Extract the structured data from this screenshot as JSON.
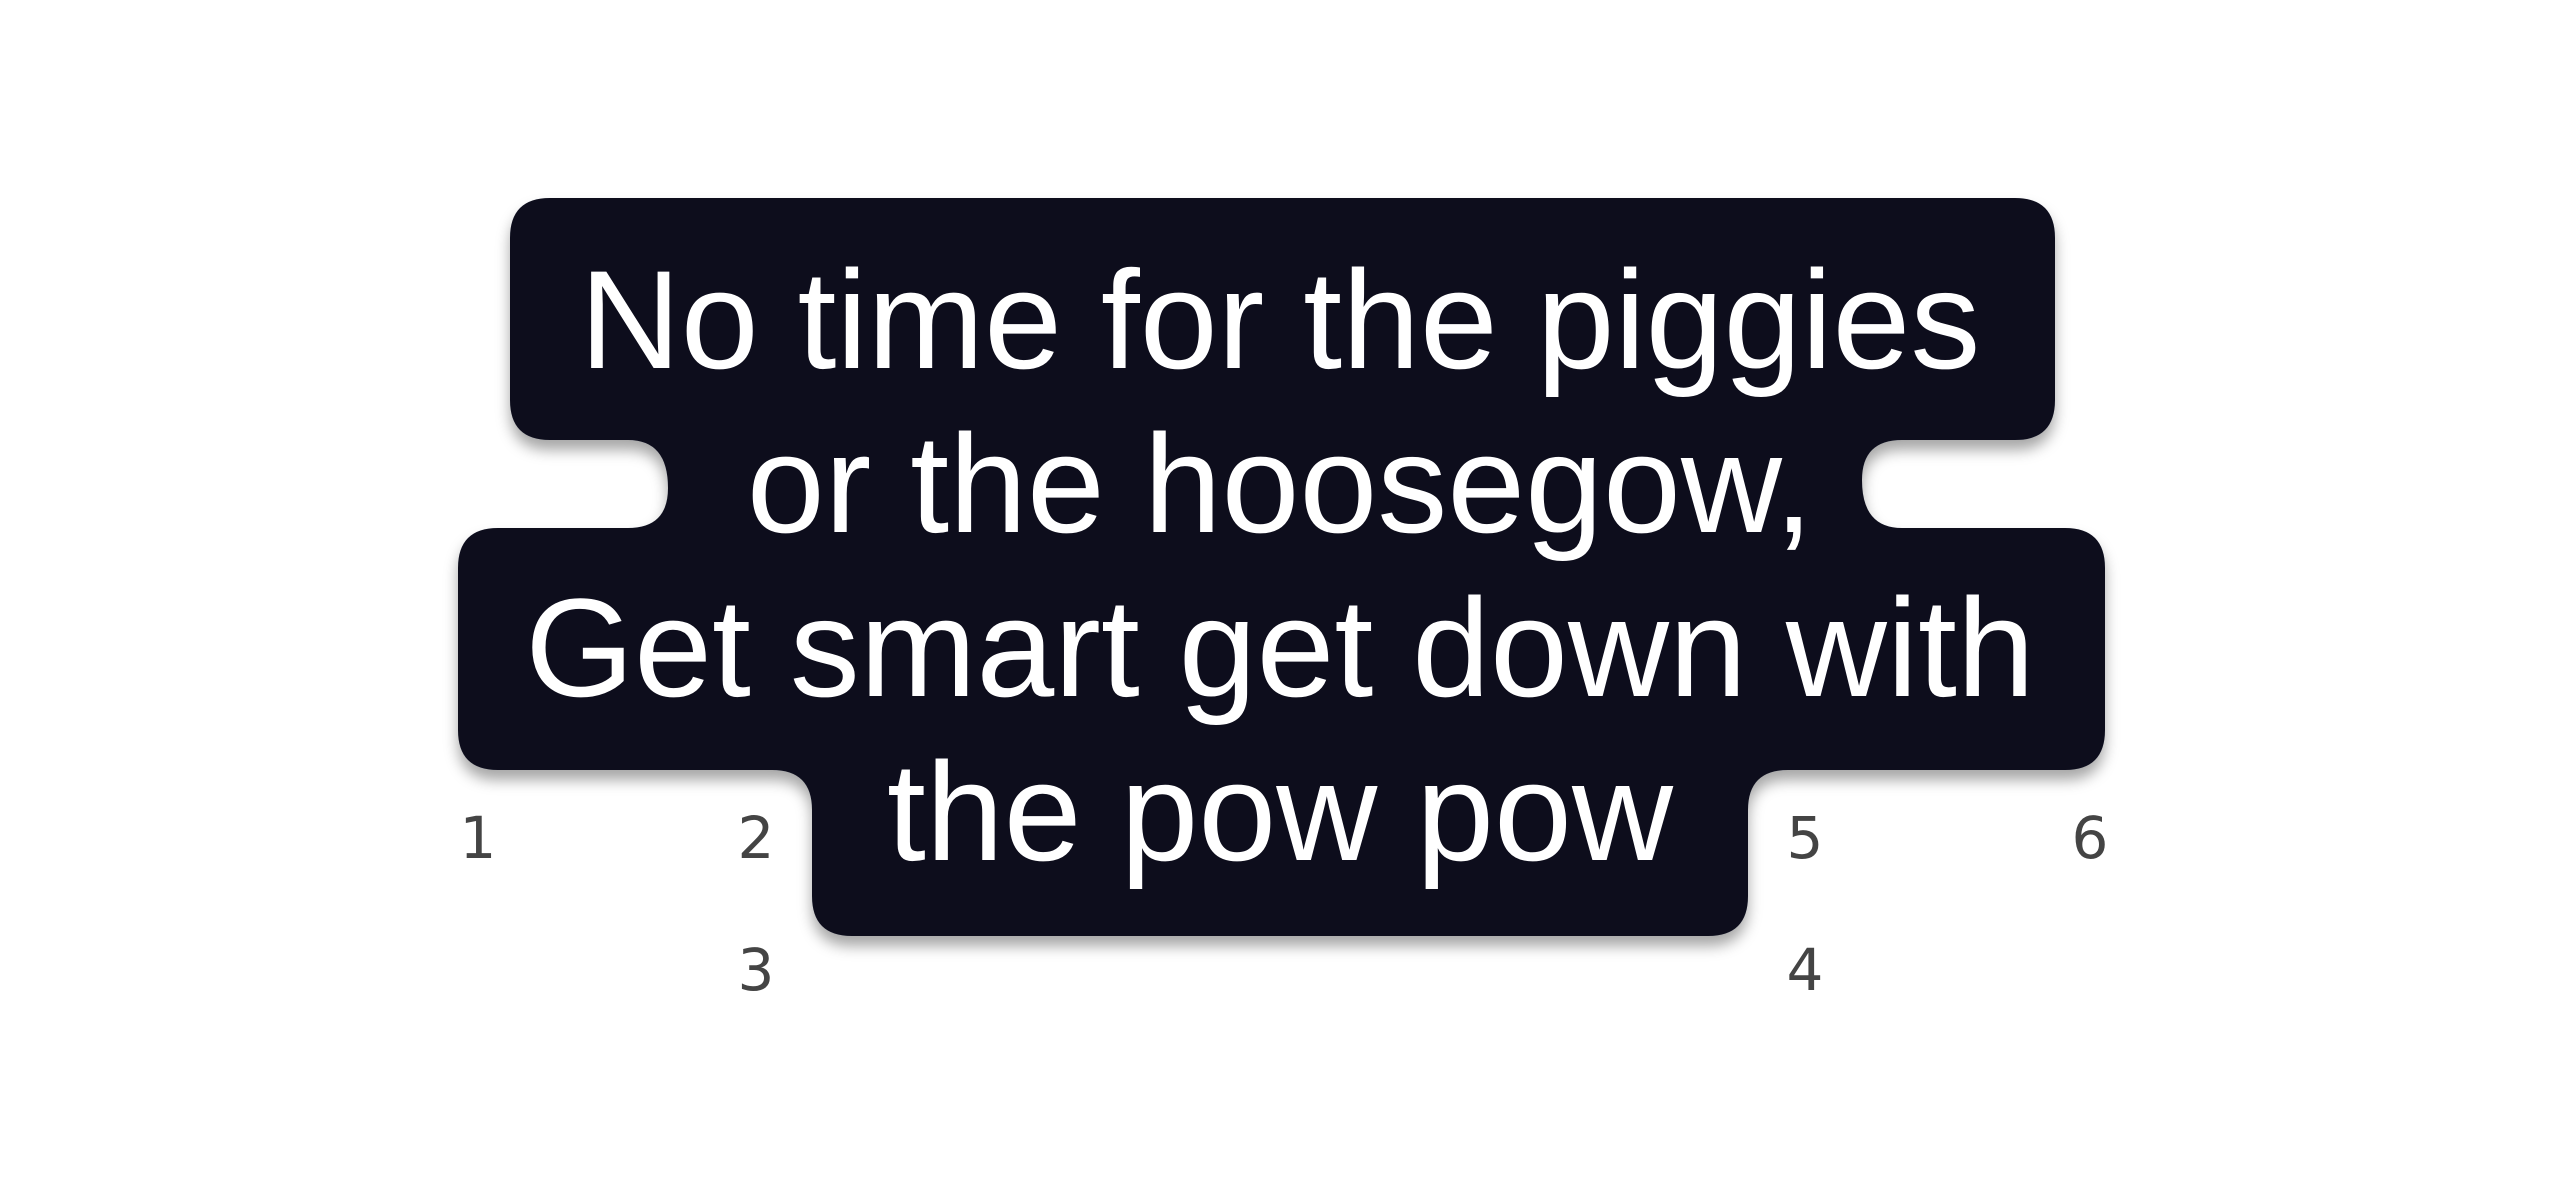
{
  "caption": {
    "lines": [
      "No time for the piggies",
      "or the hoosegow,",
      "Get smart get down with",
      "the pow pow"
    ],
    "text_color": "#ffffff",
    "background_color": "#0a0d1f"
  },
  "markers": [
    "1",
    "2",
    "3",
    "4",
    "5",
    "6"
  ],
  "marker_color": "#444444"
}
